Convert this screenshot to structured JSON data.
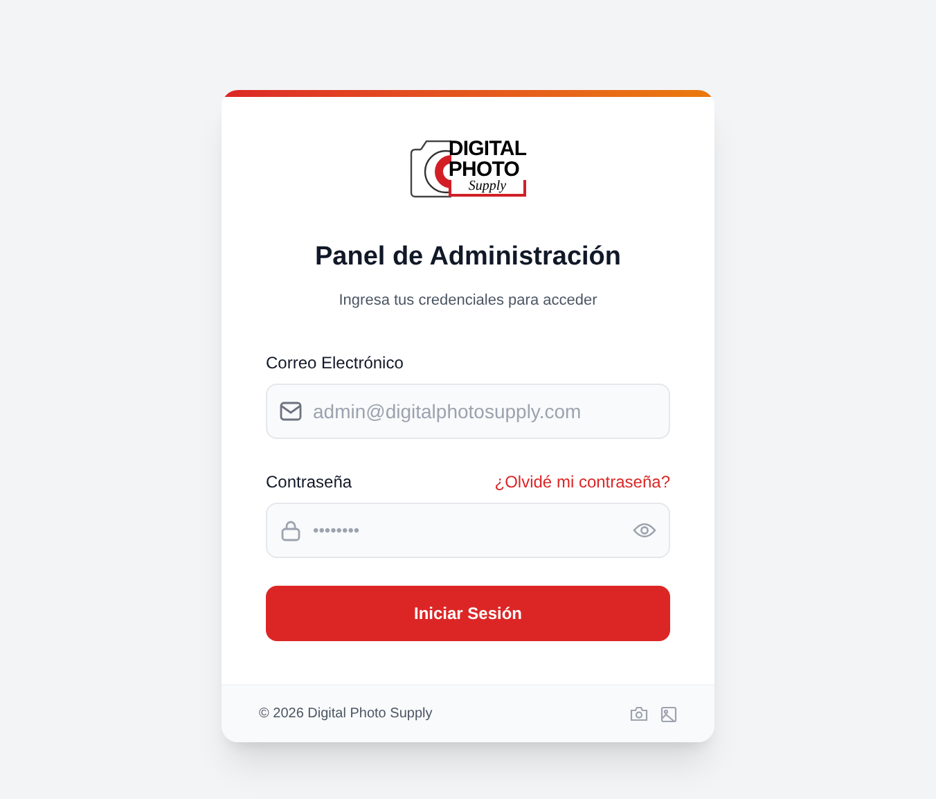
{
  "logo": {
    "line_1": "DIGITAL",
    "line_2": "PHOTO",
    "line_3": "Supply"
  },
  "title": "Panel de Administración",
  "subtitle": "Ingresa tus credenciales para acceder",
  "email": {
    "label": "Correo Electrónico",
    "placeholder": "admin@digitalphotosupply.com"
  },
  "password": {
    "label": "Contraseña",
    "forgot_link": "¿Olvidé mi contraseña?",
    "placeholder": "••••••••"
  },
  "submit_button": "Iniciar Sesión",
  "footer": {
    "copyright": "© 2026 Digital Photo Supply"
  }
}
